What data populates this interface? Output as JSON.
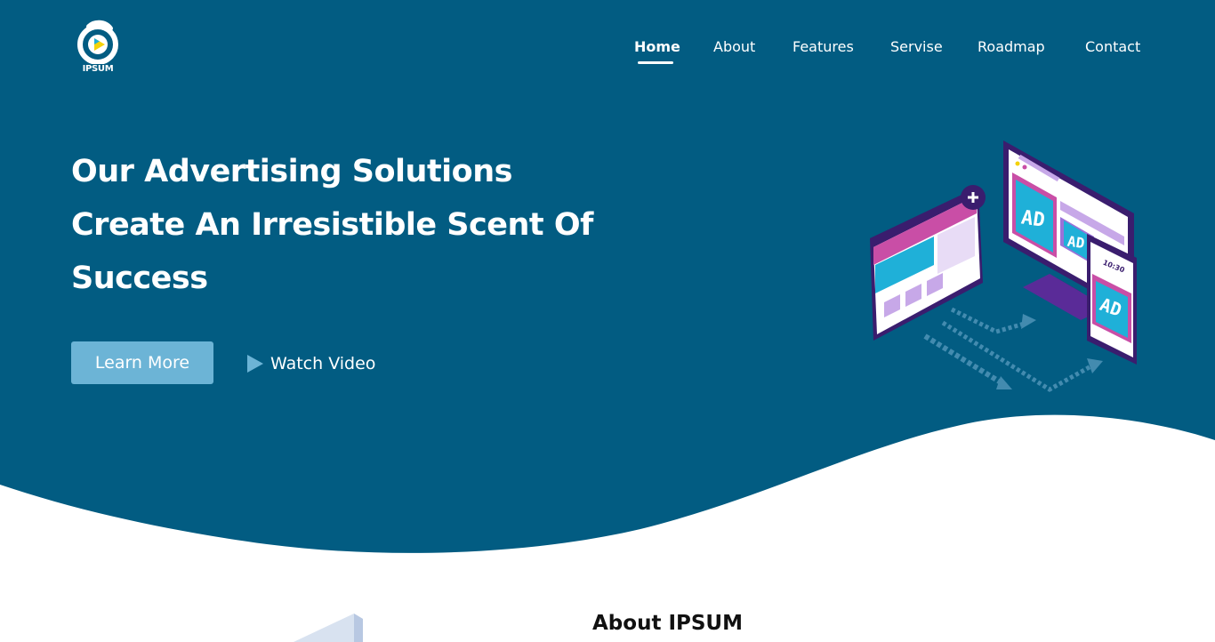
{
  "logo": {
    "text": "IPSUM",
    "icon": "ipsum-logo-icon"
  },
  "nav": {
    "items": [
      {
        "label": "Home",
        "active": true
      },
      {
        "label": "About",
        "active": false
      },
      {
        "label": "Features",
        "active": false
      },
      {
        "label": "Servise",
        "active": false
      },
      {
        "label": "Roadmap",
        "active": false
      },
      {
        "label": "Contact",
        "active": false
      }
    ]
  },
  "hero": {
    "title_lines": [
      "Our Advertising Solutions",
      "Create An Irresistible Scent Of",
      "Success"
    ],
    "learn_more_label": "Learn More",
    "watch_video_label": "Watch Video",
    "illustration_labels": {
      "monitor_ad_left": "AD",
      "monitor_ad_right": "AD",
      "phone_ad": "AD",
      "phone_time": "10:30"
    }
  },
  "about": {
    "heading": "About IPSUM"
  },
  "colors": {
    "hero_background": "#025c82",
    "button_background": "#6cb4d6",
    "text_light": "#ffffff",
    "text_dark": "#111111",
    "accent_purple": "#4a2380",
    "accent_cyan": "#1fb0d8"
  }
}
